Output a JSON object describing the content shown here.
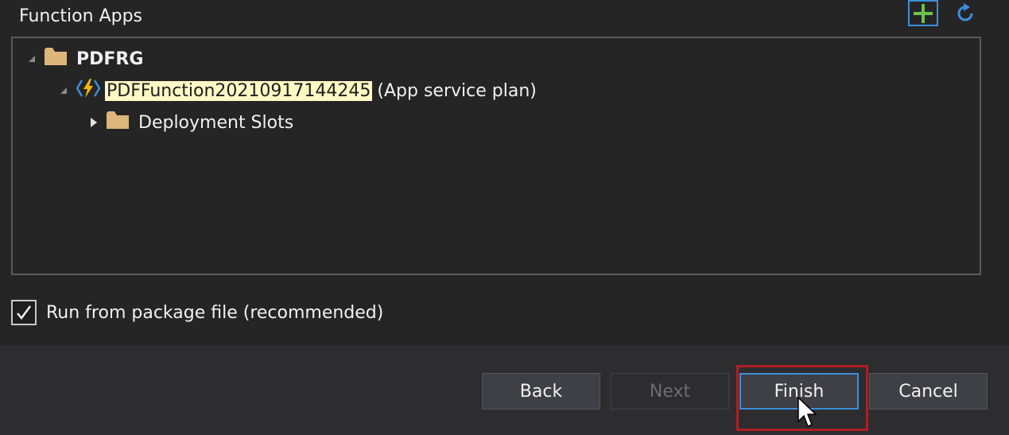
{
  "section": {
    "title": "Function Apps"
  },
  "tree": {
    "resource_group": "PDFRG",
    "function_app": {
      "name": "PDFFunction20210917144245",
      "suffix": "(App service plan)"
    },
    "deployment_slots": "Deployment Slots"
  },
  "options": {
    "run_from_package_label": "Run from package file (recommended)",
    "run_from_package_checked": true
  },
  "buttons": {
    "back": "Back",
    "next": "Next",
    "finish": "Finish",
    "cancel": "Cancel"
  },
  "colors": {
    "accent": "#3c8ed8",
    "highlight_box": "#b01e23",
    "folder": "#dcb67a",
    "add_icon": "#6cc24a",
    "name_highlight": "#fff8c4"
  }
}
